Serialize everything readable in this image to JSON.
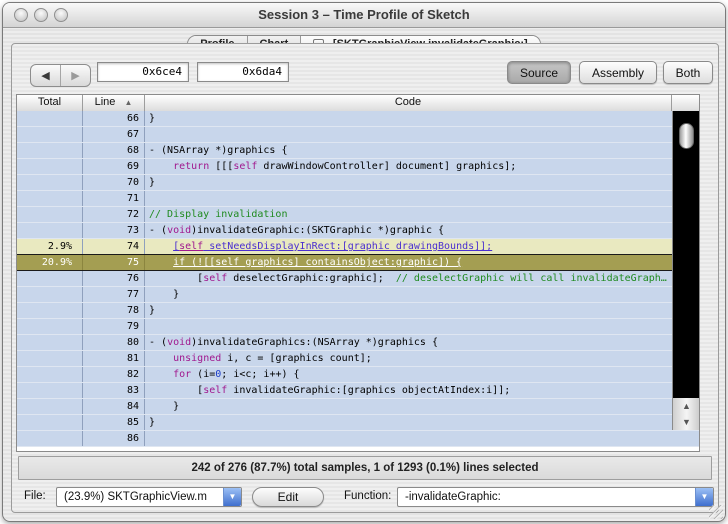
{
  "window": {
    "title": "Session 3 – Time Profile of Sketch"
  },
  "tabs": {
    "0": {
      "label": "Profile"
    },
    "1": {
      "label": "Chart"
    },
    "2": {
      "label": "-[SKTGraphicView invalidateGraphic:]",
      "close_icon": "x"
    }
  },
  "toolbar": {
    "back_icon": "◀",
    "forward_icon": "▶",
    "address_field_1": "0x6ce4",
    "address_field_2": "0x6da4",
    "view_buttons": {
      "0": {
        "label": "Source",
        "selected": true
      },
      "1": {
        "label": "Assembly",
        "selected": false
      },
      "2": {
        "label": "Both",
        "selected": false
      }
    }
  },
  "table": {
    "columns": {
      "total": "Total",
      "line": "Line",
      "code": "Code"
    },
    "sort_icon": "▲",
    "rows": [
      {
        "total": "",
        "line": "66",
        "variant": "",
        "segs": [
          [
            "}",
            "p"
          ]
        ]
      },
      {
        "total": "",
        "line": "67",
        "variant": "",
        "segs": [
          [
            "",
            "p"
          ]
        ]
      },
      {
        "total": "",
        "line": "68",
        "variant": "",
        "segs": [
          [
            "- (NSArray *)graphics {",
            "p"
          ]
        ]
      },
      {
        "total": "",
        "line": "69",
        "variant": "",
        "segs": [
          [
            "    ",
            "p"
          ],
          [
            "return",
            "k"
          ],
          [
            " [[[",
            "p"
          ],
          [
            "self",
            "k"
          ],
          [
            " drawWindowController] document] graphics];",
            "p"
          ]
        ]
      },
      {
        "total": "",
        "line": "70",
        "variant": "",
        "segs": [
          [
            "}",
            "p"
          ]
        ]
      },
      {
        "total": "",
        "line": "71",
        "variant": "",
        "segs": [
          [
            "",
            "p"
          ]
        ]
      },
      {
        "total": "",
        "line": "72",
        "variant": "",
        "segs": [
          [
            "// Display invalidation",
            "c"
          ]
        ]
      },
      {
        "total": "",
        "line": "73",
        "variant": "",
        "segs": [
          [
            "- (",
            "p"
          ],
          [
            "void",
            "k"
          ],
          [
            ")invalidateGraphic:(SKTGraphic *)graphic {",
            "p"
          ]
        ]
      },
      {
        "total": "2.9%",
        "line": "74",
        "variant": "yellow",
        "segs": [
          [
            "    ",
            "p"
          ],
          [
            "[",
            "u"
          ],
          [
            "self",
            "uk"
          ],
          [
            " setNeedsDisplayInRect:[graphic drawingBounds]];",
            "u"
          ]
        ]
      },
      {
        "total": "20.9%",
        "line": "75",
        "variant": "selected",
        "segs": [
          [
            "    ",
            "p"
          ],
          [
            "if (![[self graphics] containsObject:graphic]) {",
            "uw"
          ]
        ]
      },
      {
        "total": "",
        "line": "76",
        "variant": "",
        "segs": [
          [
            "        [",
            "p"
          ],
          [
            "self",
            "k"
          ],
          [
            " deselectGraphic:graphic];  ",
            "p"
          ],
          [
            "// deselectGraphic will call invalidateGraph…",
            "c"
          ]
        ]
      },
      {
        "total": "",
        "line": "77",
        "variant": "",
        "segs": [
          [
            "    }",
            "p"
          ]
        ]
      },
      {
        "total": "",
        "line": "78",
        "variant": "",
        "segs": [
          [
            "}",
            "p"
          ]
        ]
      },
      {
        "total": "",
        "line": "79",
        "variant": "",
        "segs": [
          [
            "",
            "p"
          ]
        ]
      },
      {
        "total": "",
        "line": "80",
        "variant": "",
        "segs": [
          [
            "- (",
            "p"
          ],
          [
            "void",
            "k"
          ],
          [
            ")invalidateGraphics:(NSArray *)graphics {",
            "p"
          ]
        ]
      },
      {
        "total": "",
        "line": "81",
        "variant": "",
        "segs": [
          [
            "    ",
            "p"
          ],
          [
            "unsigned",
            "k"
          ],
          [
            " i, c = [graphics count];",
            "p"
          ]
        ]
      },
      {
        "total": "",
        "line": "82",
        "variant": "",
        "segs": [
          [
            "    ",
            "p"
          ],
          [
            "for",
            "k"
          ],
          [
            " (i=",
            "p"
          ],
          [
            "0",
            "n"
          ],
          [
            "; i<c; i++) {",
            "p"
          ]
        ]
      },
      {
        "total": "",
        "line": "83",
        "variant": "",
        "segs": [
          [
            "        [",
            "p"
          ],
          [
            "self",
            "k"
          ],
          [
            " invalidateGraphic:[graphics objectAtIndex:i]];",
            "p"
          ]
        ]
      },
      {
        "total": "",
        "line": "84",
        "variant": "",
        "segs": [
          [
            "    }",
            "p"
          ]
        ]
      },
      {
        "total": "",
        "line": "85",
        "variant": "",
        "segs": [
          [
            "}",
            "p"
          ]
        ]
      },
      {
        "total": "",
        "line": "86",
        "variant": "",
        "segs": [
          [
            "",
            "p"
          ]
        ]
      }
    ]
  },
  "scrollbar": {
    "up_icon": "▲",
    "down_icon": "▼"
  },
  "status_bar": {
    "text": "242 of 276 (87.7%) total samples, 1 of 1293 (0.1%) lines selected"
  },
  "footer": {
    "file_label": "File:",
    "file_value": "(23.9%) SKTGraphicView.m",
    "edit_label": "Edit",
    "function_label": "Function:",
    "function_value": "-invalidateGraphic:",
    "popup_arrow_icon": "▼"
  },
  "colors": {
    "row_blue": "#c8d6eb",
    "row_yellow": "#e9e9c0",
    "row_selected": "#a49e52",
    "keyword": "#a0188e",
    "comment": "#1f8a1f",
    "popup_blue": "#3f6fce"
  }
}
